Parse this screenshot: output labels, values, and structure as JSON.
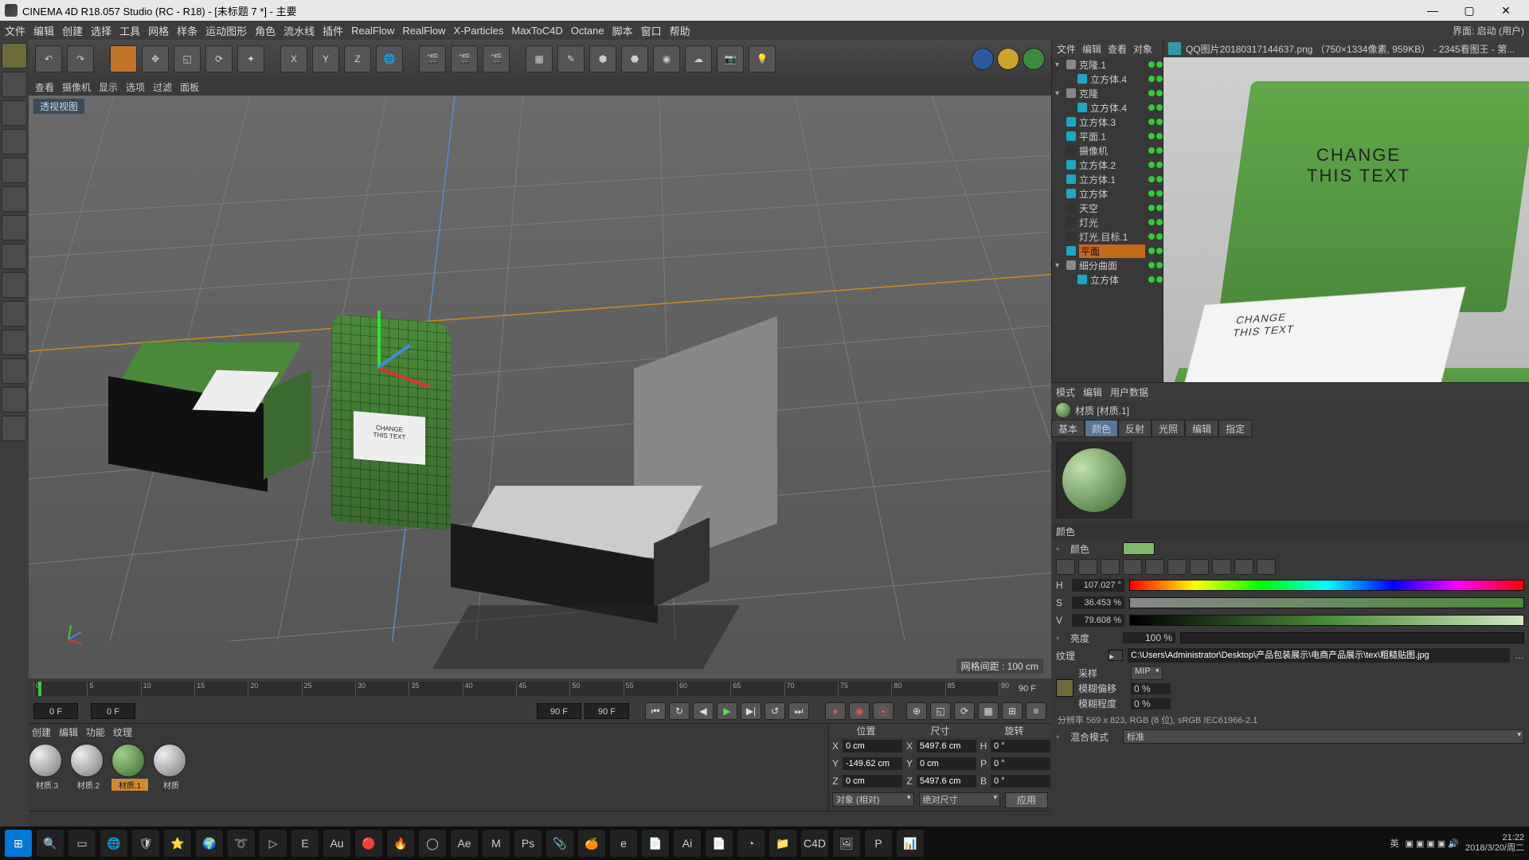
{
  "titlebar": {
    "title": "CINEMA 4D R18.057 Studio (RC - R18) - [未标题 7 *] - 主要"
  },
  "menus": [
    "文件",
    "编辑",
    "创建",
    "选择",
    "工具",
    "网格",
    "样条",
    "运动图形",
    "角色",
    "流水线",
    "插件",
    "RealFlow",
    "RealFlow",
    "X-Particles",
    "MaxToC4D",
    "Octane",
    "脚本",
    "窗口",
    "帮助"
  ],
  "menubar_right": "界面:  启动 (用户)",
  "view_sub": [
    "查看",
    "摄像机",
    "显示",
    "选项",
    "过滤",
    "面板"
  ],
  "view_label": "透视视图",
  "grid_label": "网格间距 : 100 cm",
  "timeline": {
    "start": 0,
    "end": 90,
    "step": 5,
    "end_label": "90 F"
  },
  "playbar": {
    "f_current": "0 F",
    "f_start": "0 F",
    "f_mid": "90 F",
    "f_end": "90 F"
  },
  "mat_menu": [
    "创建",
    "编辑",
    "功能",
    "纹理"
  ],
  "materials": [
    {
      "name": "材质.3",
      "green": false
    },
    {
      "name": "材质.2",
      "green": false
    },
    {
      "name": "材质.1",
      "green": true,
      "selected": true
    },
    {
      "name": "材质",
      "green": false
    }
  ],
  "coord": {
    "headers": [
      "位置",
      "尺寸",
      "旋转"
    ],
    "rows": [
      {
        "axis": "X",
        "pos": "0 cm",
        "size": "5497.6 cm",
        "rotL": "H",
        "rot": "0 °"
      },
      {
        "axis": "Y",
        "pos": "-149.62 cm",
        "size": "0 cm",
        "rotL": "P",
        "rot": "0 °"
      },
      {
        "axis": "Z",
        "pos": "0 cm",
        "size": "5497.6 cm",
        "rotL": "B",
        "rot": "0 °"
      }
    ],
    "mode": "对象 (相对)",
    "sizemode": "绝对尺寸",
    "apply": "应用"
  },
  "hier_hdr": [
    "文件",
    "编辑",
    "查看",
    "对象"
  ],
  "tree": [
    {
      "d": 0,
      "exp": "▾",
      "ico": "null",
      "lbl": "克隆.1"
    },
    {
      "d": 1,
      "exp": "",
      "ico": "cube",
      "lbl": "立方体.4"
    },
    {
      "d": 0,
      "exp": "▾",
      "ico": "null",
      "lbl": "克隆"
    },
    {
      "d": 1,
      "exp": "",
      "ico": "cube",
      "lbl": "立方体.4"
    },
    {
      "d": 0,
      "exp": "",
      "ico": "cube",
      "lbl": "立方体.3"
    },
    {
      "d": 0,
      "exp": "",
      "ico": "plane",
      "lbl": "平面.1"
    },
    {
      "d": 0,
      "exp": "",
      "ico": "cam",
      "lbl": "摄像机"
    },
    {
      "d": 0,
      "exp": "",
      "ico": "cube",
      "lbl": "立方体.2"
    },
    {
      "d": 0,
      "exp": "",
      "ico": "cube",
      "lbl": "立方体.1"
    },
    {
      "d": 0,
      "exp": "",
      "ico": "cube",
      "lbl": "立方体"
    },
    {
      "d": 0,
      "exp": "",
      "ico": "sky",
      "lbl": "天空"
    },
    {
      "d": 0,
      "exp": "",
      "ico": "light",
      "lbl": "灯光"
    },
    {
      "d": 0,
      "exp": "",
      "ico": "light",
      "lbl": "灯光.目标.1"
    },
    {
      "d": 0,
      "exp": "",
      "ico": "plane",
      "lbl": "平面",
      "sel": true
    },
    {
      "d": 0,
      "exp": "▾",
      "ico": "null",
      "lbl": "细分曲面"
    },
    {
      "d": 1,
      "exp": "",
      "ico": "cube",
      "lbl": "立方体"
    }
  ],
  "ref_title": "QQ图片20180317144637.png （750×1334像素, 959KB） - 2345看图王 - 第...",
  "ref_txt_lid1": "CHANGE",
  "ref_txt_lid2": "THIS TEXT",
  "ref_txt_stack1": "CHANGE",
  "ref_txt_stack2": "THIS TEXT",
  "attr_hdr": [
    "模式",
    "编辑",
    "用户数据"
  ],
  "attr_title": "材质 [材质.1]",
  "attr_tabs": [
    "基本",
    "颜色",
    "反射",
    "光照",
    "编辑",
    "指定"
  ],
  "attr_tab_sel": 1,
  "color_section": "颜色",
  "color_label": "颜色",
  "swatch": "#7fb86a",
  "hsv": {
    "H": "107.027 °",
    "S": "36.453 %",
    "V": "79.608 %"
  },
  "brightness_label": "亮度",
  "brightness": "100 %",
  "tex_label": "纹理",
  "tex_path": "C:\\Users\\Administrator\\Desktop\\产品包装展示\\电商产品展示\\tex\\粗糙贴图.jpg",
  "sample_label": "采样",
  "sample_val": "MIP",
  "blur_label": "模糊偏移",
  "blur_val": "0 %",
  "blurs_label": "模糊程度",
  "blurs_val": "0 %",
  "tex_info": "分辨率 569 x 823, RGB (8 位), sRGB IEC61966-2.1",
  "mix_label": "混合模式",
  "mix_val": "标准",
  "bag_label1": "CHANGE",
  "bag_label2": "THIS TEXT",
  "clock_time": "21:22",
  "clock_date": "2018/3/20/周二"
}
